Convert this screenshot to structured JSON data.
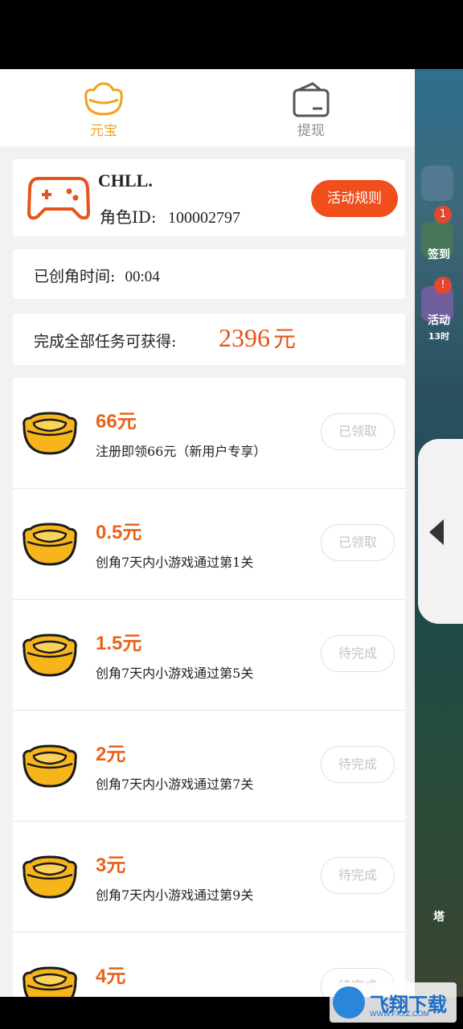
{
  "tabs": [
    {
      "label": "元宝",
      "icon": "ingot-icon",
      "active": true
    },
    {
      "label": "提现",
      "icon": "wallet-icon",
      "active": false
    }
  ],
  "user": {
    "name": "CHLL.",
    "role_id_label": "角色ID:",
    "role_id": "100002797",
    "rules_button": "活动规则"
  },
  "time": {
    "label": "已创角时间:",
    "value": "00:04"
  },
  "total": {
    "label": "完成全部任务可获得:",
    "amount": "2396",
    "unit": "元"
  },
  "tasks": [
    {
      "reward": "66元",
      "desc": "注册即领66元（新用户专享）",
      "status": "已领取"
    },
    {
      "reward": "0.5元",
      "desc": "创角7天内小游戏通过第1关",
      "status": "已领取"
    },
    {
      "reward": "1.5元",
      "desc": "创角7天内小游戏通过第5关",
      "status": "待完成"
    },
    {
      "reward": "2元",
      "desc": "创角7天内小游戏通过第7关",
      "status": "待完成"
    },
    {
      "reward": "3元",
      "desc": "创角7天内小游戏通过第9关",
      "status": "待完成"
    },
    {
      "reward": "4元",
      "desc": "",
      "status": "待完成"
    }
  ],
  "background_game": {
    "labels": [
      "签到",
      "活动",
      "13时",
      "塔"
    ],
    "badges": [
      "1",
      "!"
    ]
  },
  "watermark": {
    "text": "飞翔下载",
    "sub": "WWW.FXXZ.COM"
  },
  "colors": {
    "accent_orange": "#f04e1a",
    "reward_orange": "#e8641b",
    "tab_active": "#f0a21c",
    "ingot_gold": "#f6b51b"
  }
}
